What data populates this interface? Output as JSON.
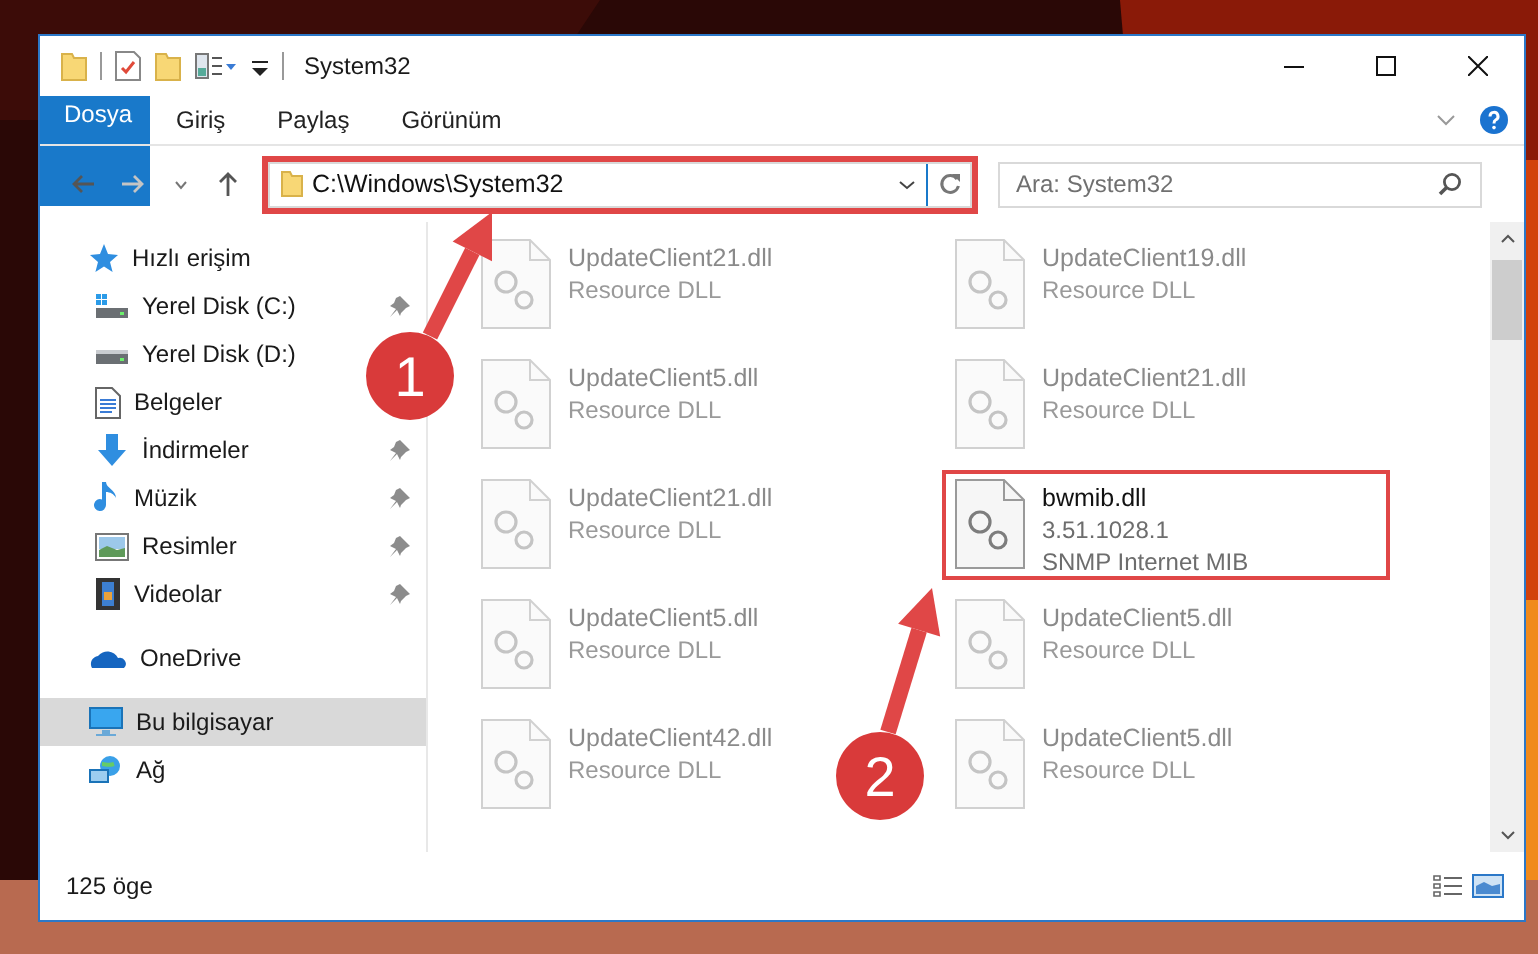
{
  "window": {
    "title": "System32"
  },
  "ribbon": {
    "tabs": [
      {
        "label": "Dosya",
        "kind": "file"
      },
      {
        "label": "Giriş",
        "kind": "tab"
      },
      {
        "label": "Paylaş",
        "kind": "tab"
      },
      {
        "label": "Görünüm",
        "kind": "tab"
      }
    ]
  },
  "navigation": {
    "address": {
      "value": "C:\\Windows\\System32",
      "highlighted": true
    },
    "search": {
      "placeholder": "Ara: System32"
    }
  },
  "sidebar": {
    "items": [
      {
        "label": "Hızlı erişim",
        "selected": false,
        "children": [
          {
            "label": "Yerel Disk (C:)",
            "pinned": true
          },
          {
            "label": "Yerel Disk (D:)",
            "pinned": false
          },
          {
            "label": "Belgeler",
            "pinned": false
          },
          {
            "label": "İndirmeler",
            "pinned": true
          },
          {
            "label": "Müzik",
            "pinned": true
          },
          {
            "label": "Resimler",
            "pinned": true
          },
          {
            "label": "Videolar",
            "pinned": true
          }
        ]
      },
      {
        "label": "OneDrive",
        "selected": false
      },
      {
        "label": "Bu bilgisayar",
        "selected": true
      },
      {
        "label": "Ağ",
        "selected": false
      }
    ]
  },
  "files": [
    {
      "name": "UpdateClient21.dll",
      "description": "Resource DLL",
      "blurred": true,
      "highlighted": false
    },
    {
      "name": "UpdateClient19.dll",
      "description": "Resource DLL",
      "blurred": true,
      "highlighted": false
    },
    {
      "name": "UpdateClient5.dll",
      "description": "Resource DLL",
      "blurred": true,
      "highlighted": false
    },
    {
      "name": "UpdateClient21.dll",
      "description": "Resource DLL",
      "blurred": true,
      "highlighted": false
    },
    {
      "name": "UpdateClient21.dll",
      "description": "Resource DLL",
      "blurred": true,
      "highlighted": false
    },
    {
      "name": "bwmib.dll",
      "version": "3.51.1028.1",
      "description": "SNMP Internet MIB",
      "blurred": false,
      "highlighted": true
    },
    {
      "name": "UpdateClient5.dll",
      "description": "Resource DLL",
      "blurred": true,
      "highlighted": false
    },
    {
      "name": "UpdateClient5.dll",
      "description": "Resource DLL",
      "blurred": true,
      "highlighted": false
    },
    {
      "name": "UpdateClient42.dll",
      "description": "Resource DLL",
      "blurred": true,
      "highlighted": false
    },
    {
      "name": "UpdateClient5.dll",
      "description": "Resource DLL",
      "blurred": true,
      "highlighted": false
    }
  ],
  "status_bar": {
    "count": "125 öge"
  },
  "annotations": [
    {
      "label": "1"
    },
    {
      "label": "2"
    }
  ]
}
